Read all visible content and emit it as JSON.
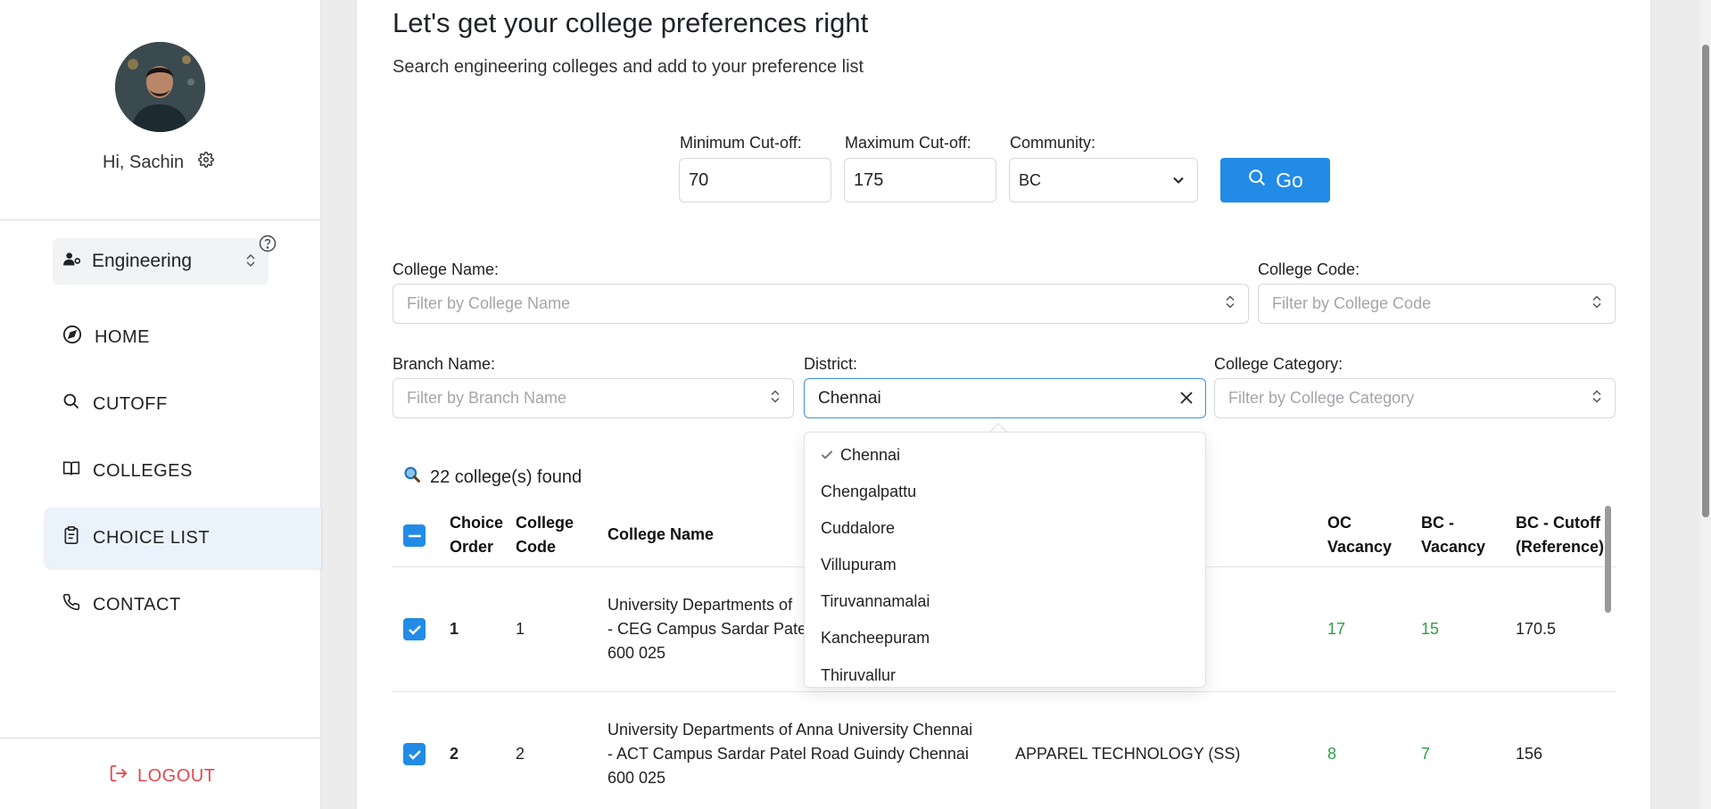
{
  "sidebar": {
    "greeting": "Hi, Sachin",
    "stream": "Engineering",
    "nav": [
      {
        "label": "HOME",
        "icon": "compass-icon"
      },
      {
        "label": "CUTOFF",
        "icon": "search-icon"
      },
      {
        "label": "COLLEGES",
        "icon": "book-icon"
      },
      {
        "label": "CHOICE LIST",
        "icon": "clipboard-icon",
        "active": true
      },
      {
        "label": "CONTACT",
        "icon": "phone-icon"
      }
    ],
    "logout": "LOGOUT"
  },
  "main": {
    "title": "Let's get your college preferences right",
    "subtitle": "Search engineering colleges and add to your preference list"
  },
  "search": {
    "min_label": "Minimum Cut-off:",
    "min_value": "70",
    "max_label": "Maximum Cut-off:",
    "max_value": "175",
    "community_label": "Community:",
    "community_value": "BC",
    "go_label": "Go"
  },
  "filters": {
    "college_name_label": "College Name:",
    "college_name_placeholder": "Filter by College Name",
    "college_code_label": "College Code:",
    "college_code_placeholder": "Filter by College Code",
    "branch_label": "Branch Name:",
    "branch_placeholder": "Filter by Branch Name",
    "district_label": "District:",
    "district_value": "Chennai",
    "category_label": "College Category:",
    "category_placeholder": "Filter by College Category"
  },
  "district_options": [
    "Chennai",
    "Chengalpattu",
    "Cuddalore",
    "Villupuram",
    "Tiruvannamalai",
    "Kancheepuram",
    "Thiruvallur"
  ],
  "results": {
    "found_text": "22 college(s) found"
  },
  "table": {
    "headers": {
      "choice_order_1": "Choice",
      "choice_order_2": "Order",
      "college_code_1": "College",
      "college_code_2": "Code",
      "college_name": "College Name",
      "oc_1": "OC",
      "oc_2": "Vacancy",
      "bc_1": "BC -",
      "bc_2": "Vacancy",
      "bcc_1": "BC - Cutoff",
      "bcc_2": "(Reference)"
    },
    "rows": [
      {
        "order": "1",
        "code": "1",
        "name_1": "University Departments of",
        "name_2": "- CEG Campus Sardar Pate",
        "name_3": "600 025",
        "branch": "",
        "oc": "17",
        "bc": "15",
        "cutoff": "170.5"
      },
      {
        "order": "2",
        "code": "2",
        "name_1": "University Departments of Anna University Chennai",
        "name_2": "- ACT Campus Sardar Patel Road Guindy Chennai",
        "name_3": "600 025",
        "branch": "APPAREL TECHNOLOGY (SS)",
        "oc": "8",
        "bc": "7",
        "cutoff": "156"
      }
    ]
  }
}
